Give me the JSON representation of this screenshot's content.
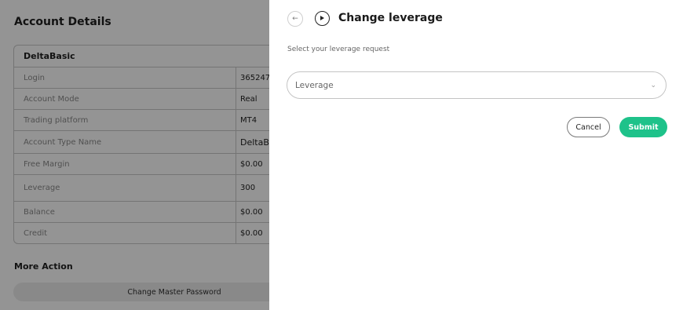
{
  "background": {
    "title": "Account Details",
    "account": {
      "name": "DeltaBasic",
      "rows": [
        {
          "label": "Login",
          "value": "365247"
        },
        {
          "label": "Account Mode",
          "value": "Real"
        },
        {
          "label": "Trading platform",
          "value": "MT4"
        },
        {
          "label": "Account Type Name",
          "value": "DeltaB"
        },
        {
          "label": "Free Margin",
          "value": "$0.00"
        },
        {
          "label": "Leverage",
          "value": "300"
        },
        {
          "label": "Balance",
          "value": "$0.00"
        },
        {
          "label": "Credit",
          "value": "$0.00"
        }
      ]
    },
    "more_action_title": "More Action",
    "change_master_password_label": "Change Master Password"
  },
  "panel": {
    "back_icon": "arrow-left-icon",
    "title_icon": "play-circle-icon",
    "title": "Change leverage",
    "subtitle": "Select your leverage request",
    "leverage_select": {
      "placeholder": "Leverage",
      "icon": "chevron-down-icon"
    },
    "cancel_label": "Cancel",
    "submit_label": "Submit"
  },
  "colors": {
    "accent": "#1ec28a",
    "overlay": "rgba(0,0,0,0.42)"
  }
}
